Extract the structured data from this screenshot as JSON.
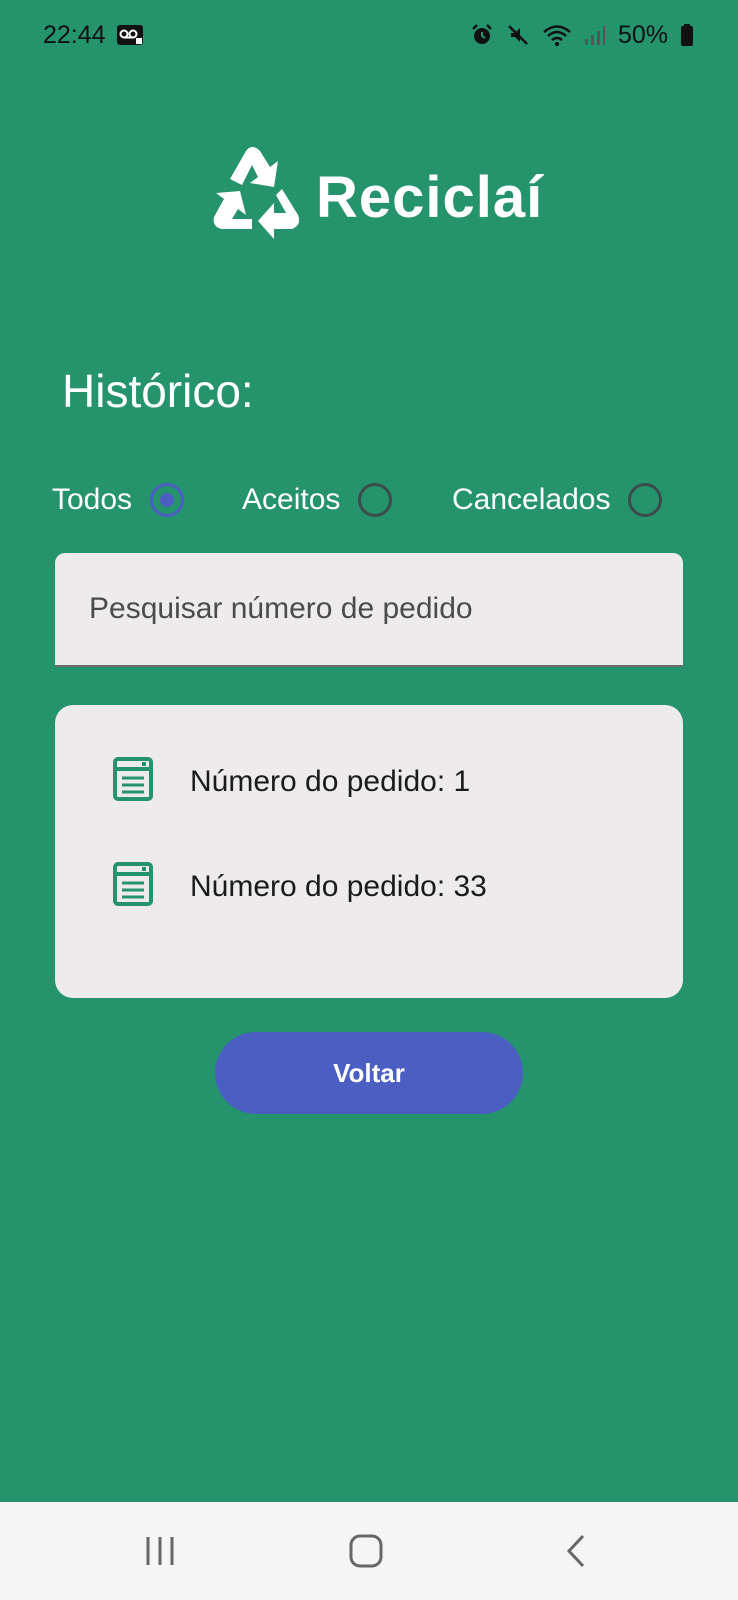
{
  "status_bar": {
    "time": "22:44",
    "battery_percent": "50%",
    "icons": [
      "voicemail-icon",
      "alarm-icon",
      "mute-icon",
      "wifi-icon",
      "signal-icon",
      "battery-icon"
    ]
  },
  "app": {
    "name": "Reciclaí",
    "logo_icon": "recycle-icon"
  },
  "page": {
    "title": "Histórico:"
  },
  "filters": [
    {
      "label": "Todos",
      "checked": true
    },
    {
      "label": "Aceitos",
      "checked": false
    },
    {
      "label": "Cancelados",
      "checked": false
    }
  ],
  "search": {
    "placeholder": "Pesquisar número de pedido",
    "value": ""
  },
  "orders": [
    {
      "label": "Número do pedido: 1",
      "icon": "receipt-icon"
    },
    {
      "label": "Número do pedido: 33",
      "icon": "receipt-icon"
    }
  ],
  "actions": {
    "back_label": "Voltar"
  },
  "colors": {
    "background": "#25936c",
    "accent": "#4a5fc1",
    "card": "#eeebec"
  },
  "nav": {
    "icons": [
      "recent-apps-icon",
      "home-icon",
      "back-icon"
    ]
  }
}
